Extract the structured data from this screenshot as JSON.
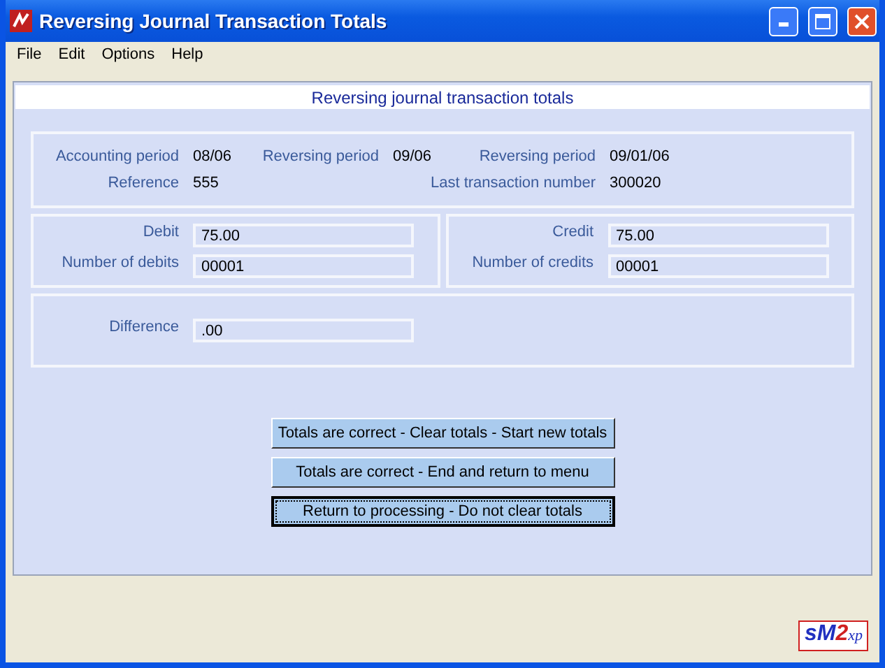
{
  "window": {
    "title": "Reversing Journal Transaction Totals"
  },
  "menu": [
    "File",
    "Edit",
    "Options",
    "Help"
  ],
  "header": "Reversing journal transaction totals",
  "info": [
    {
      "label": "Accounting period",
      "value": "08/06"
    },
    {
      "label": "Reversing period",
      "value": "09/06"
    },
    {
      "label": "Reversing period",
      "value": "09/01/06"
    },
    {
      "label": "Reference",
      "value": "555"
    },
    {
      "label": "Last transaction number",
      "value": "300020"
    }
  ],
  "debits": [
    {
      "label": "Debit",
      "value": "75.00"
    },
    {
      "label": "Number of debits",
      "value": "00001"
    }
  ],
  "credits": [
    {
      "label": "Credit",
      "value": "75.00"
    },
    {
      "label": "Number of credits",
      "value": "00001"
    }
  ],
  "difference": {
    "label": "Difference",
    "value": ".00"
  },
  "buttons": [
    {
      "label": "Totals are correct - Clear totals - Start new totals",
      "focused": false
    },
    {
      "label": "Totals are correct - End and return to menu",
      "focused": false
    },
    {
      "label": "Return to processing - Do not clear totals",
      "focused": true
    }
  ],
  "logo": [
    "s",
    "M",
    "2",
    "xp"
  ]
}
